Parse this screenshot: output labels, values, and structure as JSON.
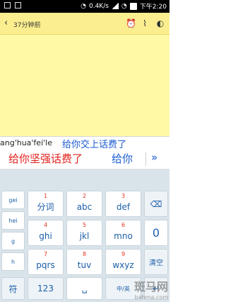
{
  "status_bar": {
    "network_speed": "0.4K/s",
    "time": "下午2:20"
  },
  "header": {
    "back_icon": "chevron-left-icon",
    "time_ago": "37分钟前",
    "icons": [
      "alarm-icon",
      "attachment-icon",
      "palette-icon"
    ]
  },
  "candidates": {
    "pinyin": "ang'hua'fei'le",
    "pinyin_candidate": "给你交上话费了",
    "primary": "给你坚强话费了",
    "secondary": "给你",
    "more": "»"
  },
  "keyboard": {
    "left_column": [
      "gei",
      "hei",
      "g",
      "h"
    ],
    "row1": [
      {
        "hint": "1",
        "label": "分词"
      },
      {
        "hint": "2",
        "label": "abc"
      },
      {
        "hint": "3",
        "label": "def"
      }
    ],
    "row2": [
      {
        "hint": "4",
        "label": "ghi"
      },
      {
        "hint": "5",
        "label": "jkl"
      },
      {
        "hint": "6",
        "label": "mno"
      }
    ],
    "row3": [
      {
        "hint": "7",
        "label": "pqrs"
      },
      {
        "hint": "8",
        "label": "tuv"
      },
      {
        "hint": "9",
        "label": "wxyz"
      }
    ],
    "row4": [
      {
        "label": "符"
      },
      {
        "label": "123"
      },
      {
        "label": "␣"
      },
      {
        "label": "中/英"
      },
      {
        "label": "↵"
      }
    ],
    "right_column": [
      "⌫",
      "0",
      "清空",
      "↵"
    ],
    "accent": "#1b5ea8"
  },
  "watermark": {
    "text": "斑马网",
    "sub": "bahma.com"
  }
}
